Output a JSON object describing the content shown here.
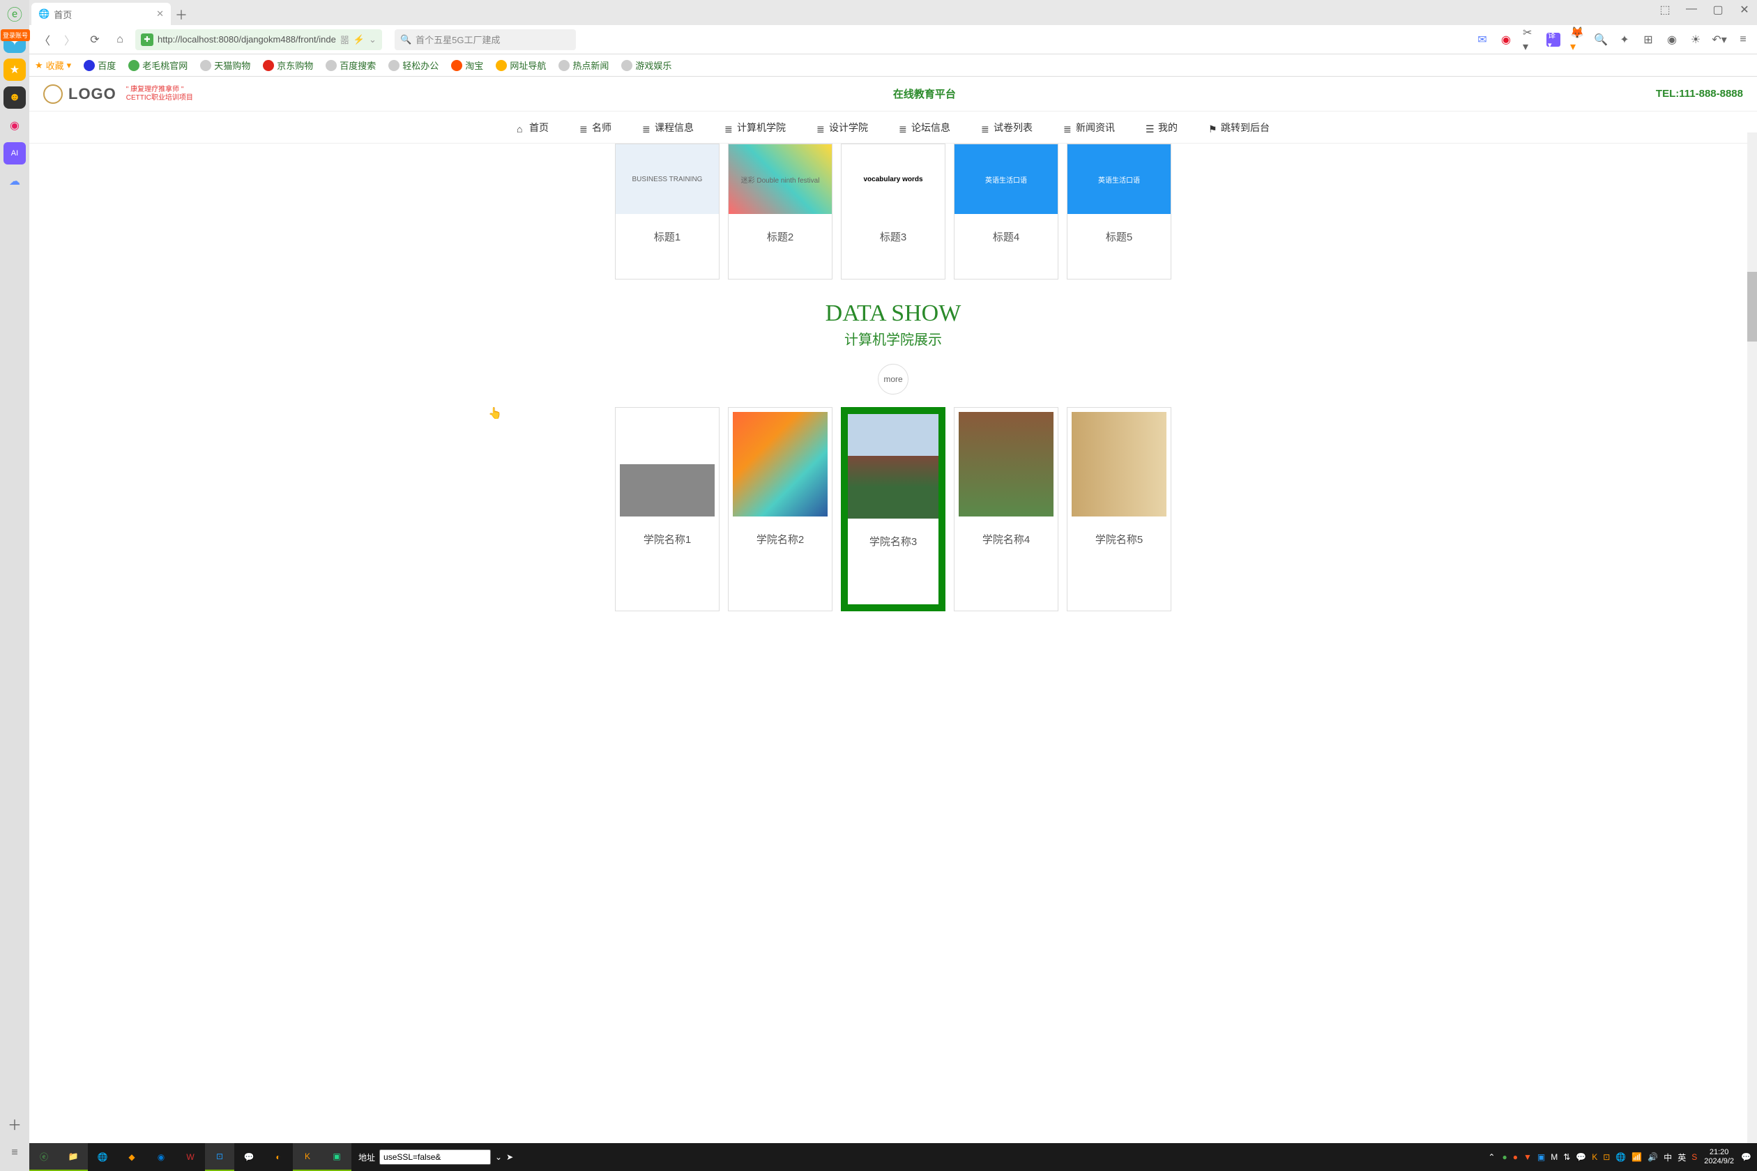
{
  "browser": {
    "tab_title": "首页",
    "url": "http://localhost:8080/djangokm488/front/inde",
    "search_placeholder": "首个五星5G工厂建成"
  },
  "sidebar_login": "登录账号",
  "bookmarks": {
    "fav": "收藏",
    "items": [
      "百度",
      "老毛桃官网",
      "天猫购物",
      "京东购物",
      "百度搜索",
      "轻松办公",
      "淘宝",
      "网址导航",
      "热点新闻",
      "游戏娱乐"
    ]
  },
  "site": {
    "logo": "LOGO",
    "logo_sub1": "\" 康复理疗推拿师 \"",
    "logo_sub2": "CETTIC职业培训项目",
    "title": "在线教育平台",
    "tel": "TEL:111-888-8888"
  },
  "nav": [
    "首页",
    "名师",
    "课程信息",
    "计算机学院",
    "设计学院",
    "论坛信息",
    "试卷列表",
    "新闻资讯",
    "我的",
    "跳转到后台"
  ],
  "cards_top": [
    {
      "title": "标题1",
      "img": "BUSINESS TRAINING"
    },
    {
      "title": "标题2",
      "img": "迷彩 Double ninth festival"
    },
    {
      "title": "标题3",
      "img": "vocabulary words"
    },
    {
      "title": "标题4",
      "img": "英语生活口语"
    },
    {
      "title": "标题5",
      "img": "英语生活口语"
    }
  ],
  "section": {
    "heading": "DATA SHOW",
    "subheading": "计算机学院展示",
    "more": "more"
  },
  "cards_bottom": [
    {
      "title": "学院名称1"
    },
    {
      "title": "学院名称2"
    },
    {
      "title": "学院名称3",
      "active": true
    },
    {
      "title": "学院名称4"
    },
    {
      "title": "学院名称5"
    }
  ],
  "taskbar": {
    "addr_label": "地址",
    "addr_value": "useSSL=false&",
    "lang1": "中",
    "lang2": "英",
    "time": "21:20",
    "date": "2024/9/2"
  }
}
